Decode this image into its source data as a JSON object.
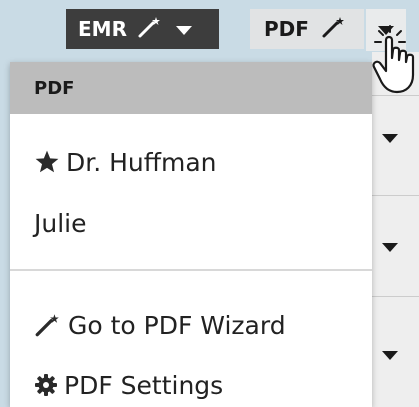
{
  "toolbar": {
    "emr_label": "EMR",
    "emr_wand_icon": "magic-wand-icon",
    "emr_caret_icon": "caret-down-icon",
    "pdf_label": "PDF",
    "pdf_wand_icon": "magic-wand-icon",
    "pdf_caret_icon": "caret-down-icon"
  },
  "menu": {
    "header": "PDF",
    "favorites": [
      {
        "label": "Dr. Huffman",
        "icon": "star-icon",
        "starred": true
      },
      {
        "label": "Julie",
        "starred": false
      }
    ],
    "actions": [
      {
        "label": "Go to PDF Wizard",
        "icon": "magic-wand-icon"
      },
      {
        "label": "PDF Settings",
        "icon": "gear-icon"
      }
    ]
  },
  "colors": {
    "toolbar_bg": "#c9dbe5",
    "emr_button_bg": "#3d3d3d",
    "pdf_button_bg": "#e1e3e4",
    "menu_header_bg": "#bcbcbc",
    "menu_bg": "#ffffff"
  }
}
